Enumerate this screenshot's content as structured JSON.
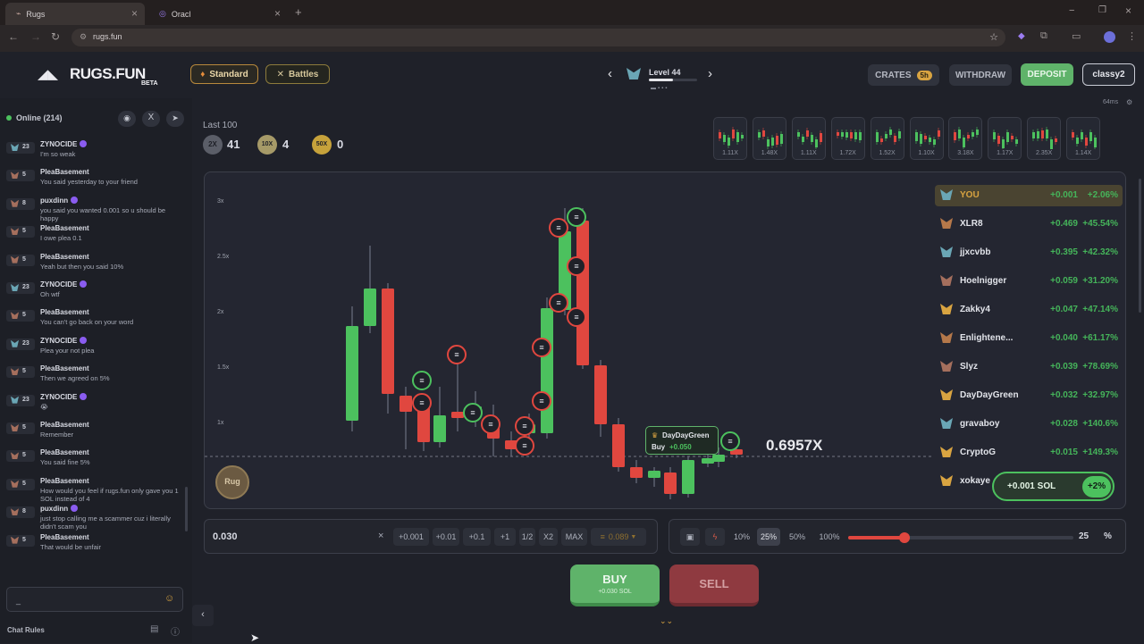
{
  "browser": {
    "tabs": [
      {
        "label": "Rugs"
      },
      {
        "label": "Oracl"
      }
    ],
    "url": "rugs.fun"
  },
  "header": {
    "logo": "RUGS.FUN",
    "logo_badge": "BETA",
    "mode_standard": "Standard",
    "mode_battles": "Battles",
    "level": "Level 44",
    "crates": "CRATES",
    "crates_badge": "5h",
    "withdraw": "WITHDRAW",
    "deposit": "DEPOSIT",
    "username": "classy2",
    "ping": "64ms"
  },
  "sidebar": {
    "online": "Online (214)",
    "messages": [
      {
        "level": "23",
        "user": "ZYNOCIDE",
        "verified": true,
        "text": "I'm so weak",
        "tier": "t"
      },
      {
        "level": "5",
        "user": "PleaBasement",
        "verified": false,
        "text": "You said yesterday to your friend",
        "tier": "b"
      },
      {
        "level": "8",
        "user": "puxdinn",
        "verified": true,
        "text": "you said you wanted 0.001 so u should be happy",
        "tier": "b"
      },
      {
        "level": "5",
        "user": "PleaBasement",
        "verified": false,
        "text": "I owe plea 0.1",
        "tier": "b"
      },
      {
        "level": "5",
        "user": "PleaBasement",
        "verified": false,
        "text": "Yeah but then you said 10%",
        "tier": "b"
      },
      {
        "level": "23",
        "user": "ZYNOCIDE",
        "verified": true,
        "text": "Oh wtf",
        "tier": "t"
      },
      {
        "level": "5",
        "user": "PleaBasement",
        "verified": false,
        "text": "You can't go back on your word",
        "tier": "b"
      },
      {
        "level": "23",
        "user": "ZYNOCIDE",
        "verified": true,
        "text": "Plea your not plea",
        "tier": "t"
      },
      {
        "level": "5",
        "user": "PleaBasement",
        "verified": false,
        "text": "Then we agreed on 5%",
        "tier": "b"
      },
      {
        "level": "23",
        "user": "ZYNOCIDE",
        "verified": true,
        "text": "😭",
        "tier": "t"
      },
      {
        "level": "5",
        "user": "PleaBasement",
        "verified": false,
        "text": "Remember",
        "tier": "b"
      },
      {
        "level": "5",
        "user": "PleaBasement",
        "verified": false,
        "text": "You said fine 5%",
        "tier": "b"
      },
      {
        "level": "5",
        "user": "PleaBasement",
        "verified": false,
        "text": "How would you feel if rugs.fun only gave you 1 SOL instead of 4",
        "tier": "b"
      },
      {
        "level": "8",
        "user": "puxdinn",
        "verified": true,
        "text": "just stop calling me a scammer cuz i literally didn't scam you",
        "tier": "b"
      },
      {
        "level": "5",
        "user": "PleaBasement",
        "verified": false,
        "text": "That would be unfair",
        "tier": "b"
      }
    ],
    "chat_input": "_",
    "chat_rules": "Chat Rules"
  },
  "stats": {
    "last100": "Last 100",
    "x2_label": "2X",
    "x2_count": "41",
    "x10_label": "10X",
    "x10_count": "4",
    "x50_label": "50X",
    "x50_count": "0"
  },
  "history": [
    "1.11X",
    "1.48X",
    "1.11X",
    "1.72X",
    "1.52X",
    "1.10X",
    "3.18X",
    "1.17X",
    "2.35X",
    "1.14X"
  ],
  "chart_data": {
    "type": "candlestick",
    "y_ticks": [
      "3x",
      "2.5x",
      "2x",
      "1.5x",
      "1x"
    ],
    "current_multiplier": "0.6957X",
    "tooltip_user": "DayDayGreen",
    "tooltip_action": "Buy",
    "tooltip_amount": "+0.050",
    "rug_label": "Rug"
  },
  "leaderboard": [
    {
      "name": "YOU",
      "pnl": "+0.001",
      "pct": "+2.06%",
      "icon": "#6aa6b5"
    },
    {
      "name": "XLR8",
      "pnl": "+0.469",
      "pct": "+45.54%",
      "icon": "#b5784a"
    },
    {
      "name": "jjxcvbb",
      "pnl": "+0.395",
      "pct": "+42.32%",
      "icon": "#6aa6b5"
    },
    {
      "name": "Hoelnigger",
      "pnl": "+0.059",
      "pct": "+31.20%",
      "icon": "#a56f5d"
    },
    {
      "name": "Zakky4",
      "pnl": "+0.047",
      "pct": "+47.14%",
      "icon": "#d9a441"
    },
    {
      "name": "Enlightene...",
      "pnl": "+0.040",
      "pct": "+61.17%",
      "icon": "#b5784a"
    },
    {
      "name": "Slyz",
      "pnl": "+0.039",
      "pct": "+78.69%",
      "icon": "#a56f5d"
    },
    {
      "name": "DayDayGreen",
      "pnl": "+0.032",
      "pct": "+32.97%",
      "icon": "#d9a441"
    },
    {
      "name": "gravaboy",
      "pnl": "+0.028",
      "pct": "+140.6%",
      "icon": "#6aa6b5"
    },
    {
      "name": "CryptoG",
      "pnl": "+0.015",
      "pct": "+149.3%",
      "icon": "#d9a441"
    },
    {
      "name": "xokaye",
      "pnl": "",
      "pct": "",
      "icon": "#d9a441"
    }
  ],
  "position": {
    "sol": "+0.001 SOL",
    "pct": "+2%"
  },
  "trade": {
    "amount": "0.030",
    "clear": "×",
    "quick": [
      "+0.001",
      "+0.01",
      "+0.1",
      "+1",
      "1/2",
      "X2",
      "MAX"
    ],
    "balance": "0.089",
    "pct_buttons": [
      "10%",
      "25%",
      "50%",
      "100%"
    ],
    "slider_value": 25,
    "slider_text": "25",
    "slider_unit": "%",
    "buy": "BUY",
    "buy_sub": "+0.030 SOL",
    "sell": "SELL"
  }
}
